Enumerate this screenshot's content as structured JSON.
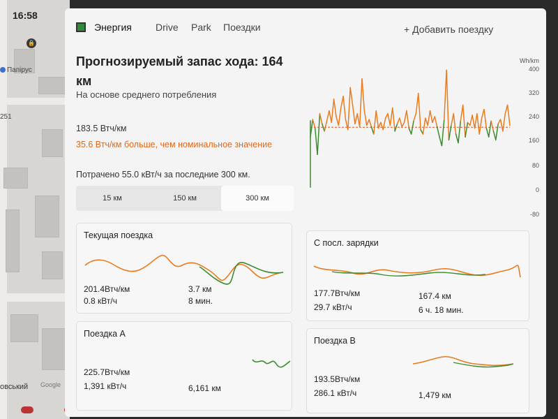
{
  "status": {
    "time": "16:58"
  },
  "map": {
    "poi_label": "Папірус",
    "number_label": "251",
    "street_label": "овський",
    "google_label": "Google"
  },
  "header": {
    "tabs": [
      {
        "label": "Энергия"
      },
      {
        "label": "Drive"
      },
      {
        "label": "Park"
      },
      {
        "label": "Поездки"
      }
    ],
    "add_trip": "+ Добавить поездку"
  },
  "energy": {
    "title": "Прогнозируемый запас хода: 164 км",
    "subtitle": "На основе среднего потребления",
    "consumption": "183.5 Втч/км",
    "consumption_diff": "35.6 Втч/км больше, чем номинальное значение",
    "spent": "Потрачено 55.0 кВт/ч за последние 300 км.",
    "ranges": [
      {
        "label": "15 км"
      },
      {
        "label": "150 км"
      },
      {
        "label": "300 км"
      }
    ],
    "selected_range": "300 км",
    "unit": "Wh/km",
    "y_ticks": [
      "400",
      "320",
      "240",
      "160",
      "80",
      "0",
      "-80"
    ]
  },
  "chart_data": {
    "type": "line",
    "unit": "Wh/km",
    "ylim": [
      -80,
      400
    ],
    "reference_value": 183.5,
    "colors": {
      "above": "#e87c1e",
      "below": "#3c8a2e",
      "reference": "#d9551c"
    },
    "values": [
      150,
      210,
      180,
      90,
      230,
      195,
      170,
      205,
      240,
      200,
      280,
      220,
      190,
      250,
      290,
      210,
      175,
      320,
      260,
      195,
      230,
      185,
      350,
      240,
      190,
      210,
      185,
      160,
      240,
      180,
      200,
      175,
      215,
      230,
      190,
      250,
      170,
      195,
      215,
      185,
      200,
      240,
      180,
      160,
      205,
      230,
      300,
      175,
      160,
      215,
      190,
      240,
      200,
      220,
      185,
      150,
      120,
      210,
      380,
      140,
      190,
      230,
      160,
      130,
      205,
      260,
      150,
      200,
      190,
      225,
      180,
      230,
      160,
      215,
      245,
      180,
      150,
      205,
      170,
      140,
      195,
      210,
      170,
      230,
      260,
      190
    ]
  },
  "cards": {
    "current": {
      "title": "Текущая поездка",
      "consumption": "201.4Втч/км",
      "energy": "0.8 кВт/ч",
      "distance": "3.7 км",
      "time": "8 мин."
    },
    "since_charge": {
      "title": "С посл. зарядки",
      "consumption": "177.7Втч/км",
      "energy": "29.7 кВт/ч",
      "distance": "167.4 км",
      "time": "6 ч. 18 мин."
    },
    "trip_a": {
      "title": "Поездка A",
      "consumption": "225.7Втч/км",
      "energy": "1,391 кВт/ч",
      "distance": "6,161 км"
    },
    "trip_b": {
      "title": "Поездка B",
      "consumption": "193.5Втч/км",
      "energy": "286.1 кВт/ч",
      "distance": "1,479 км"
    }
  }
}
